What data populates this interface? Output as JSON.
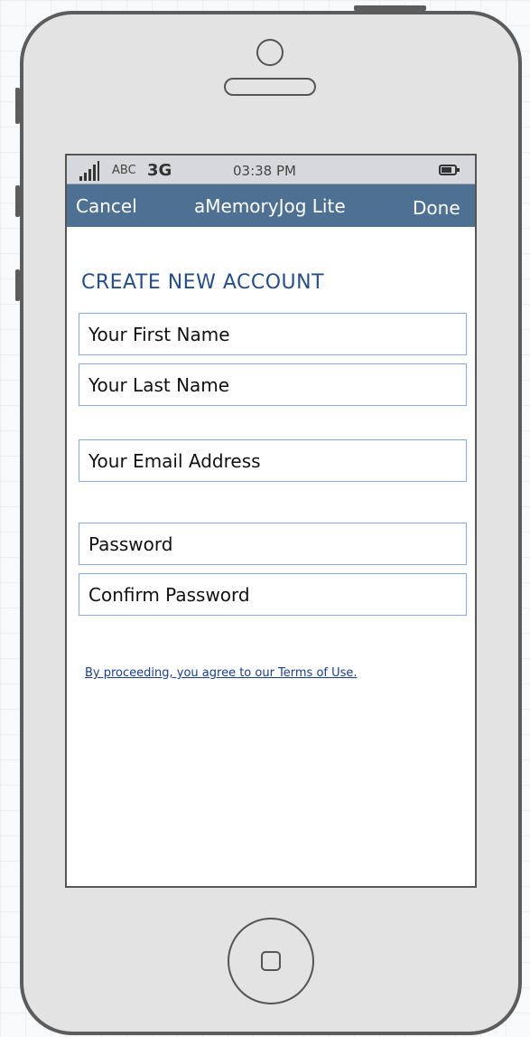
{
  "status_bar": {
    "carrier": "ABC",
    "network": "3G",
    "time": "03:38 PM",
    "signal_icon": "signal-bars-icon",
    "battery_icon": "battery-icon"
  },
  "nav_bar": {
    "cancel_label": "Cancel",
    "title": "aMemoryJog Lite",
    "done_label": "Done",
    "background_color": "#4e7193"
  },
  "form": {
    "heading": "CREATE NEW ACCOUNT",
    "heading_color": "#264f8a",
    "fields": {
      "first_name": {
        "placeholder": "Your First Name",
        "value": ""
      },
      "last_name": {
        "placeholder": "Your Last Name",
        "value": ""
      },
      "email": {
        "placeholder": "Your Email Address",
        "value": ""
      },
      "password": {
        "placeholder": "Password",
        "value": ""
      },
      "confirm_password": {
        "placeholder": "Confirm Password",
        "value": ""
      }
    },
    "terms_link": "By proceeding, you agree to our Terms of Use."
  },
  "device": {
    "home_button_icon": "home-button-icon",
    "camera_icon": "camera-icon",
    "speaker_icon": "speaker-icon"
  }
}
